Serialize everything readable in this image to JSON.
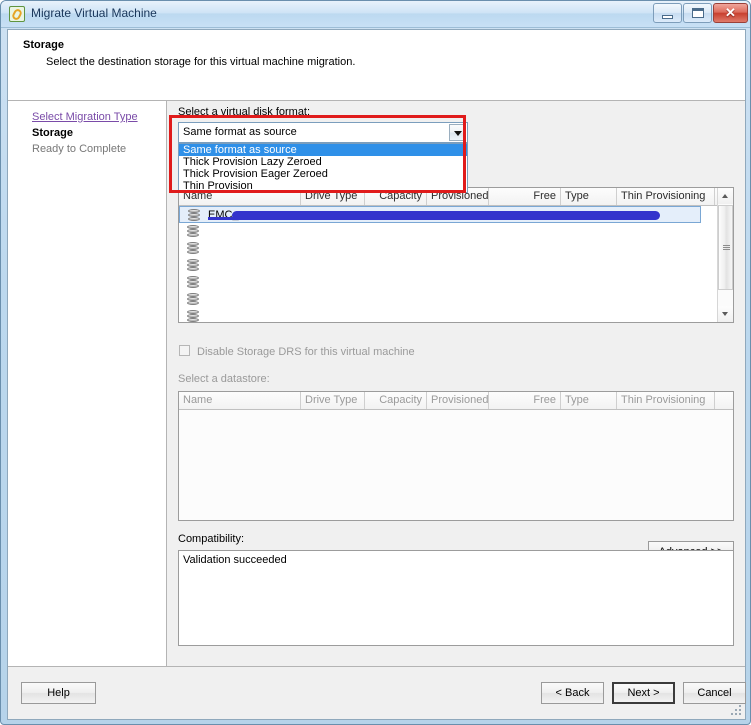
{
  "window": {
    "title": "Migrate Virtual Machine",
    "icon": "migrate-vm-icon",
    "minimize_label": "Minimize",
    "maximize_label": "Maximize",
    "close_label": "✕"
  },
  "header": {
    "title": "Storage",
    "subtitle": "Select the destination storage for this virtual machine migration."
  },
  "sidebar": {
    "items": [
      {
        "label": "Select Migration Type",
        "state": "completed"
      },
      {
        "label": "Storage",
        "state": "current"
      },
      {
        "label": "Ready to Complete",
        "state": "future"
      }
    ]
  },
  "disk_format": {
    "label": "Select a virtual disk format:",
    "selected": "Same format as source",
    "options": [
      "Same format as source",
      "Thick Provision Lazy Zeroed",
      "Thick Provision Eager Zeroed",
      "Thin Provision"
    ],
    "dropdown_open": true,
    "highlight_color": "#e01b1b",
    "selection_color": "#2f90e8"
  },
  "datastore_table": {
    "columns": [
      "Name",
      "Drive Type",
      "Capacity",
      "Provisioned",
      "Free",
      "Type",
      "Thin Provisioning"
    ],
    "rows": [
      {
        "name": "EMC_",
        "redacted": true,
        "selected": true
      },
      {
        "name": "",
        "redacted": false,
        "selected": false
      },
      {
        "name": "",
        "redacted": false,
        "selected": false
      },
      {
        "name": "",
        "redacted": false,
        "selected": false
      },
      {
        "name": "",
        "redacted": false,
        "selected": false
      },
      {
        "name": "",
        "redacted": false,
        "selected": false
      },
      {
        "name": "",
        "redacted": false,
        "selected": false
      }
    ]
  },
  "drs": {
    "checkbox_label": "Disable Storage DRS for this virtual machine",
    "checked": false,
    "enabled": false
  },
  "datastore_sub": {
    "label": "Select a datastore:",
    "columns": [
      "Name",
      "Drive Type",
      "Capacity",
      "Provisioned",
      "Free",
      "Type",
      "Thin Provisioning"
    ],
    "rows": [],
    "enabled": false
  },
  "advanced": {
    "label": "Advanced >>"
  },
  "compatibility": {
    "label": "Compatibility:",
    "message": "Validation succeeded"
  },
  "footer": {
    "help_label": "Help",
    "back_label": "< Back",
    "next_label": "Next >",
    "cancel_label": "Cancel"
  }
}
